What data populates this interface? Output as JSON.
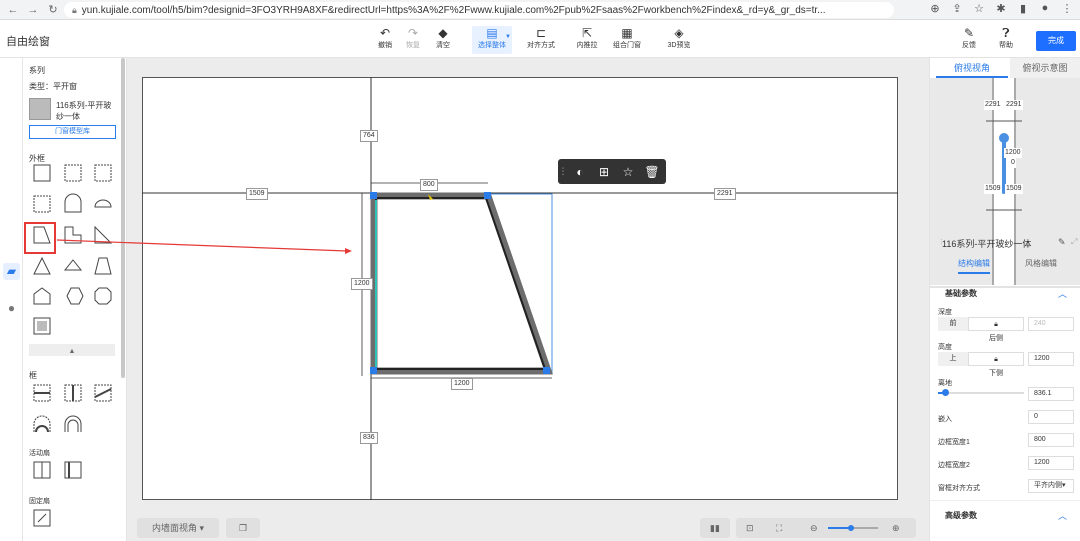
{
  "browser": {
    "url": "yun.kujiale.com/tool/h5/bim?designid=3FO3YRH9A8XF&redirectUrl=https%3A%2F%2Fwww.kujiale.com%2Fpub%2Fsaas%2Fworkbench%2Findex&_rd=y&_gr_ds=tr..."
  },
  "app": {
    "title": "自由绘窗",
    "toolbar": [
      {
        "label": "撤销",
        "icon": "↶"
      },
      {
        "label": "恢复",
        "icon": "↷"
      },
      {
        "label": "清空",
        "icon": "◆"
      },
      {
        "label": "选择整体",
        "icon": "▤"
      },
      {
        "label": "对齐方式",
        "icon": "⊏"
      },
      {
        "label": "内推拉",
        "icon": "⇱"
      },
      {
        "label": "组合门窗",
        "icon": "▦"
      },
      {
        "label": "3D预览",
        "icon": "◈"
      }
    ],
    "feedback_label": "反馈",
    "help_label": "帮助",
    "done_label": "完成"
  },
  "left_panel": {
    "series_title": "系列",
    "type_label": "类型：平开窗",
    "product_name": "116系列-平开玻纱一体",
    "library_button": "门窗模型库",
    "outer_frame_title": "外框",
    "frame_title": "框",
    "active_sash_title": "活动扇",
    "fixed_sash_title": "固定扇"
  },
  "canvas": {
    "dims": {
      "top_left": "764",
      "left_horizontal": "1509",
      "top_width": "800",
      "right_horizontal": "2291",
      "height": "1200",
      "bottom_width": "1200",
      "bottom_left": "836"
    },
    "view_select": "内墙面视角",
    "zoom_level": 0.45
  },
  "right_panel": {
    "tab_top": "俯视视角",
    "tab_diagram": "俯视示意图",
    "minimap_dims": {
      "tl": "2291",
      "tr": "2291",
      "mid": "1200",
      "zero": "0",
      "bl": "1509",
      "br": "1509"
    },
    "product_title": "116系列-平开玻纱一体",
    "tab_structure": "结构编辑",
    "tab_style": "风格编辑",
    "basic_params": "基础参数",
    "depth_label": "深度",
    "depth_front": "前",
    "depth_back": "后侧",
    "depth_value": "240",
    "height_label": "高度",
    "height_up": "上",
    "height_down": "下侧",
    "height_value": "1200",
    "ground_label": "离地",
    "ground_value": "836.1",
    "embed_label": "嵌入",
    "embed_value": "0",
    "border_w1_label": "边框宽度1",
    "border_w1_value": "800",
    "border_w2_label": "边框宽度2",
    "border_w2_value": "1200",
    "align_label": "窗框对齐方式",
    "align_value": "平齐内侧",
    "advanced_params": "高级参数"
  }
}
